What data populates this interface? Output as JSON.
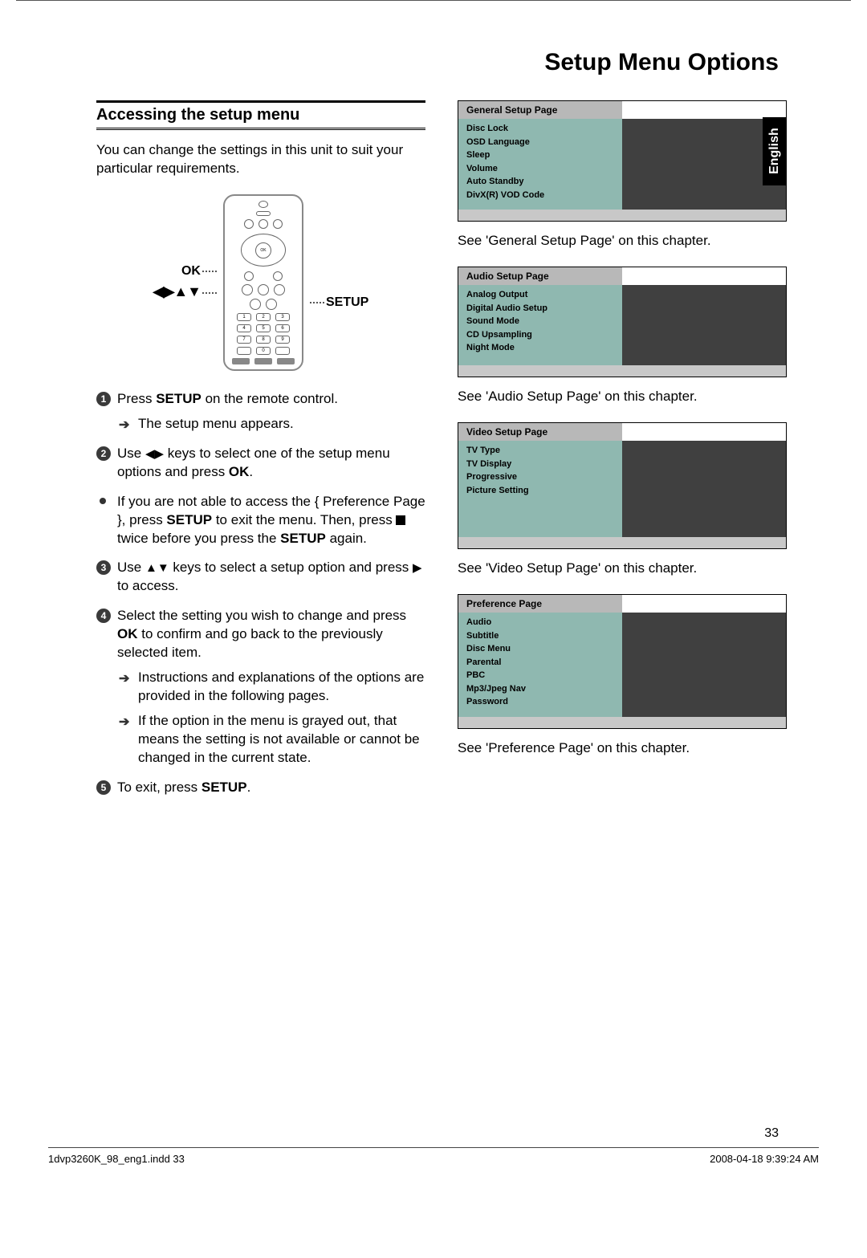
{
  "main_title": "Setup Menu Options",
  "lang_tab": "English",
  "section_title": "Accessing the setup menu",
  "intro": "You can change the settings in this unit to suit your particular requirements.",
  "remote_labels": {
    "ok": "OK",
    "arrows": "◀▶▲▼",
    "setup": "SETUP"
  },
  "steps": {
    "s1_a": "Press ",
    "s1_b": "SETUP",
    "s1_c": " on the remote control.",
    "s1_sub": "The setup menu appears.",
    "s2_a": "Use ",
    "s2_b": " keys to select one of the setup menu options and press ",
    "s2_c": "OK",
    "s2_d": ".",
    "s2_bullet_a": "If you are not able to access the { Preference Page }, press ",
    "s2_bullet_b": "SETUP",
    "s2_bullet_c": " to exit the menu. Then, press ",
    "s2_bullet_d": " twice before you press the ",
    "s2_bullet_e": "SETUP",
    "s2_bullet_f": " again.",
    "s3_a": "Use ",
    "s3_b": " keys to select a setup option and press ",
    "s3_c": " to access.",
    "s4_a": "Select the setting you wish to change and press ",
    "s4_b": "OK",
    "s4_c": " to confirm and go back to the previously selected item.",
    "s4_sub1": "Instructions and explanations of the options are provided in the following pages.",
    "s4_sub2": "If the option in the menu is grayed out, that means the setting is not available or cannot be changed in the current state.",
    "s5_a": "To exit, press ",
    "s5_b": "SETUP",
    "s5_c": "."
  },
  "menus": {
    "general": {
      "header": "General Setup Page",
      "items": [
        "Disc Lock",
        "OSD Language",
        "Sleep",
        "Volume",
        "Auto Standby",
        "DivX(R) VOD Code"
      ],
      "caption": "See 'General Setup Page' on this chapter."
    },
    "audio": {
      "header": "Audio Setup Page",
      "items": [
        "Analog Output",
        "Digital Audio Setup",
        "Sound Mode",
        "CD Upsampling",
        "Night Mode"
      ],
      "caption": "See 'Audio Setup Page' on this chapter."
    },
    "video": {
      "header": "Video Setup Page",
      "items": [
        "TV Type",
        "TV Display",
        "Progressive",
        "Picture Setting"
      ],
      "caption": "See 'Video Setup Page' on this chapter."
    },
    "preference": {
      "header": "Preference Page",
      "items": [
        "Audio",
        "Subtitle",
        "Disc Menu",
        "Parental",
        "PBC",
        "Mp3/Jpeg Nav",
        "Password"
      ],
      "caption": "See 'Preference Page' on this chapter."
    }
  },
  "page_number": "33",
  "footer_left": "1dvp3260K_98_eng1.indd   33",
  "footer_right": "2008-04-18   9:39:24 AM"
}
